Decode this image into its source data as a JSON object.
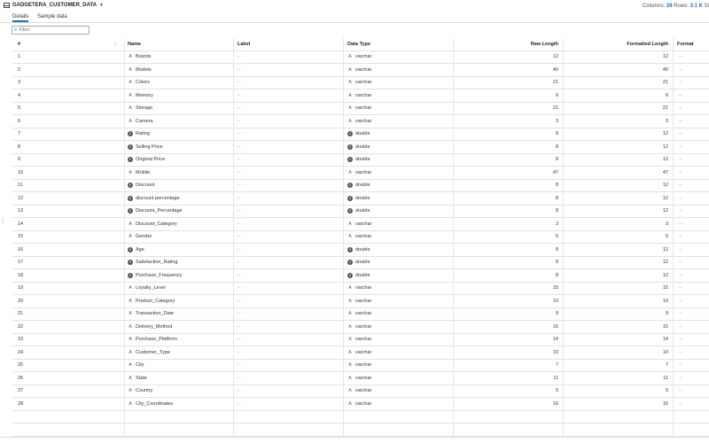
{
  "header": {
    "table_name": "GADGETERA_CUSTOMER_DATA",
    "columns_label": "Columns:",
    "columns_value": "29",
    "rows_label": "Rows:",
    "rows_value": "3.1 K",
    "truncated": "Si"
  },
  "tabs": [
    {
      "label": "Details"
    },
    {
      "label": "Sample data"
    }
  ],
  "filter": {
    "placeholder": "Filter"
  },
  "table": {
    "headers": {
      "num": "#",
      "name": "Name",
      "label": "Label",
      "data_type": "Data Type",
      "raw_length": "Raw Length",
      "formatted_length": "Formatted Length",
      "format": "Format"
    },
    "rows": [
      {
        "num": "1",
        "name": "Brands",
        "label": "--",
        "type": "varchar",
        "raw": "12",
        "fmt": "12",
        "format": "--"
      },
      {
        "num": "2",
        "name": "Models",
        "label": "--",
        "type": "varchar",
        "raw": "40",
        "fmt": "40",
        "format": "--"
      },
      {
        "num": "3",
        "name": "Colors",
        "label": "--",
        "type": "varchar",
        "raw": "21",
        "fmt": "21",
        "format": "--"
      },
      {
        "num": "4",
        "name": "Memory",
        "label": "--",
        "type": "varchar",
        "raw": "6",
        "fmt": "6",
        "format": "--"
      },
      {
        "num": "5",
        "name": "Storage",
        "label": "--",
        "type": "varchar",
        "raw": "21",
        "fmt": "21",
        "format": "--"
      },
      {
        "num": "6",
        "name": "Camera",
        "label": "--",
        "type": "varchar",
        "raw": "3",
        "fmt": "3",
        "format": "--"
      },
      {
        "num": "7",
        "name": "Rating",
        "label": "--",
        "type": "double",
        "raw": "8",
        "fmt": "12",
        "format": "--"
      },
      {
        "num": "8",
        "name": "Selling Price",
        "label": "--",
        "type": "double",
        "raw": "8",
        "fmt": "12",
        "format": "--"
      },
      {
        "num": "9",
        "name": "Original Price",
        "label": "--",
        "type": "double",
        "raw": "8",
        "fmt": "12",
        "format": "--"
      },
      {
        "num": "10",
        "name": "Mobile",
        "label": "--",
        "type": "varchar",
        "raw": "47",
        "fmt": "47",
        "format": "--"
      },
      {
        "num": "11",
        "name": "Discount",
        "label": "--",
        "type": "double",
        "raw": "8",
        "fmt": "12",
        "format": "--"
      },
      {
        "num": "12",
        "name": "discount percentage",
        "label": "--",
        "type": "double",
        "raw": "8",
        "fmt": "12",
        "format": "--"
      },
      {
        "num": "13",
        "name": "Discount_Percentage",
        "label": "--",
        "type": "double",
        "raw": "8",
        "fmt": "12",
        "format": "--"
      },
      {
        "num": "14",
        "name": "Discount_Category",
        "label": "--",
        "type": "varchar",
        "raw": "3",
        "fmt": "3",
        "format": "--"
      },
      {
        "num": "15",
        "name": "Gender",
        "label": "--",
        "type": "varchar",
        "raw": "6",
        "fmt": "6",
        "format": "--"
      },
      {
        "num": "16",
        "name": "Age",
        "label": "--",
        "type": "double",
        "raw": "8",
        "fmt": "12",
        "format": "--"
      },
      {
        "num": "17",
        "name": "Satisfaction_Rating",
        "label": "--",
        "type": "double",
        "raw": "8",
        "fmt": "12",
        "format": "--"
      },
      {
        "num": "18",
        "name": "Purchase_Frequency",
        "label": "--",
        "type": "double",
        "raw": "8",
        "fmt": "12",
        "format": "--"
      },
      {
        "num": "19",
        "name": "Loyalty_Level",
        "label": "--",
        "type": "varchar",
        "raw": "15",
        "fmt": "15",
        "format": "--"
      },
      {
        "num": "20",
        "name": "Product_Category",
        "label": "--",
        "type": "varchar",
        "raw": "10",
        "fmt": "10",
        "format": "--"
      },
      {
        "num": "21",
        "name": "Transaction_Date",
        "label": "--",
        "type": "varchar",
        "raw": "9",
        "fmt": "9",
        "format": "--"
      },
      {
        "num": "22",
        "name": "Delivery_Method",
        "label": "--",
        "type": "varchar",
        "raw": "15",
        "fmt": "15",
        "format": "--"
      },
      {
        "num": "23",
        "name": "Purchase_Platform",
        "label": "--",
        "type": "varchar",
        "raw": "14",
        "fmt": "14",
        "format": "--"
      },
      {
        "num": "24",
        "name": "Customer_Type",
        "label": "--",
        "type": "varchar",
        "raw": "10",
        "fmt": "10",
        "format": "--"
      },
      {
        "num": "25",
        "name": "City",
        "label": "--",
        "type": "varchar",
        "raw": "7",
        "fmt": "7",
        "format": "--"
      },
      {
        "num": "26",
        "name": "State",
        "label": "--",
        "type": "varchar",
        "raw": "11",
        "fmt": "11",
        "format": "--"
      },
      {
        "num": "27",
        "name": "Country",
        "label": "--",
        "type": "varchar",
        "raw": "5",
        "fmt": "5",
        "format": "--"
      },
      {
        "num": "28",
        "name": "City_Coordinates",
        "label": "--",
        "type": "varchar",
        "raw": "16",
        "fmt": "16",
        "format": "--"
      }
    ]
  },
  "icons": {
    "table": "table-icon",
    "filter": "search-icon",
    "sort": "sort-arrow-icon",
    "varchar": "text-type-icon",
    "double": "numeric-type-icon"
  },
  "colors": {
    "accent": "#1f6fc5"
  }
}
